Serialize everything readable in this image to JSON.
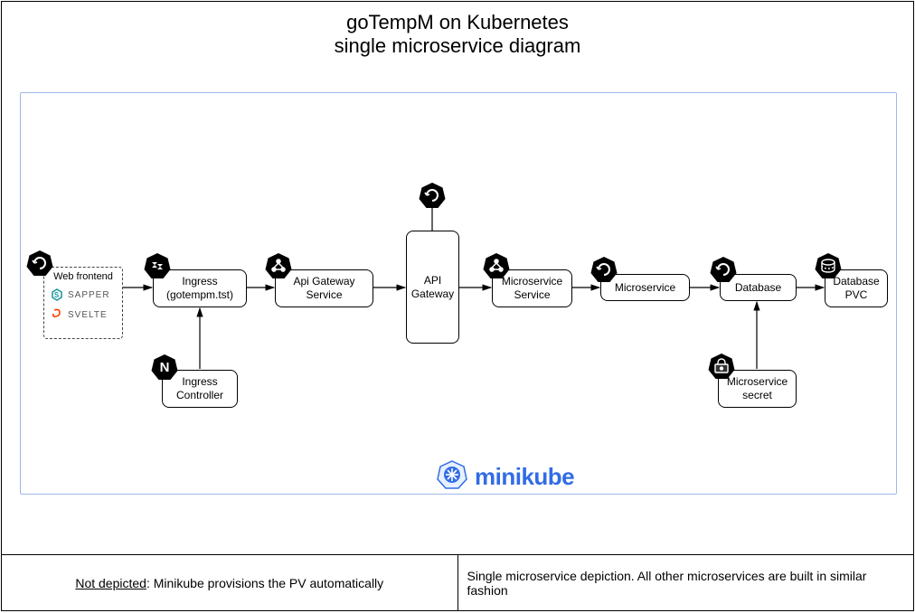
{
  "title": {
    "line1": "goTempM on Kubernetes",
    "line2": "single microservice diagram"
  },
  "cluster": {
    "platform": "minikube"
  },
  "nodes": {
    "web_frontend": {
      "label": "Web frontend"
    },
    "sapper": {
      "label": "SAPPER"
    },
    "svelte": {
      "label": "SVELTE"
    },
    "ingress": {
      "label_line1": "Ingress",
      "label_line2": "(gotempm.tst)"
    },
    "ingress_controller": {
      "label_line1": "Ingress",
      "label_line2": "Controller"
    },
    "api_gateway_service": {
      "label_line1": "Api Gateway",
      "label_line2": "Service"
    },
    "api_gateway": {
      "label_line1": "API",
      "label_line2": "Gateway"
    },
    "microservice_service": {
      "label_line1": "Microservice",
      "label_line2": "Service"
    },
    "microservice": {
      "label": "Microservice"
    },
    "database": {
      "label": "Database"
    },
    "database_pvc": {
      "label_line1": "Database",
      "label_line2": "PVC"
    },
    "microservice_secret": {
      "label_line1": "Microservice",
      "label_line2": "secret"
    }
  },
  "icons": {
    "deployment": "deployment-icon",
    "service": "service-icon",
    "ingress": "ingress-icon",
    "pvc": "pvc-icon",
    "secret": "secret-icon",
    "nginx": "nginx-icon",
    "sapper": "sapper-icon",
    "svelte": "svelte-icon",
    "minikube": "minikube-icon"
  },
  "footer": {
    "left_prefix": "Not depicted",
    "left_rest": ": Minikube provisions the PV automatically",
    "right": "Single microservice depiction. All other microservices are built in similar fashion"
  }
}
